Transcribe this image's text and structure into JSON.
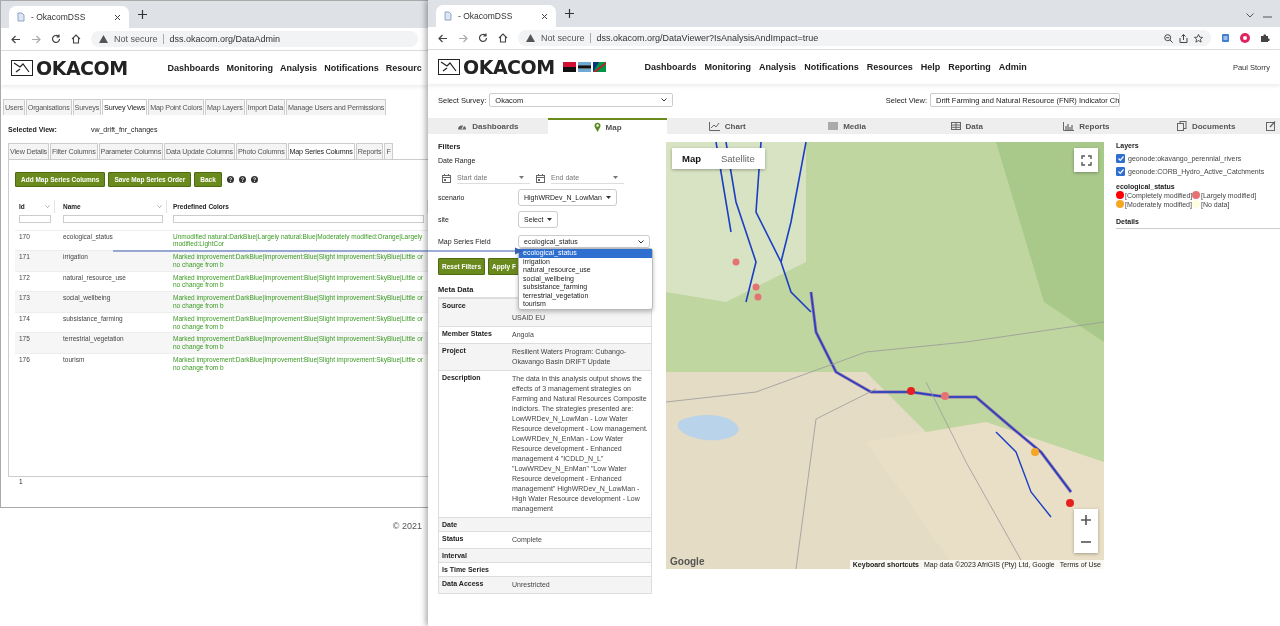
{
  "admin_window": {
    "tab_title": "- OkacomDSS",
    "security": "Not secure",
    "url": "dss.okacom.org/DataAdmin",
    "logo": "OKACOM",
    "nav": [
      "Dashboards",
      "Monitoring",
      "Analysis",
      "Notifications",
      "Resourc"
    ],
    "admin_tabs": [
      {
        "label": "Users",
        "selected": false
      },
      {
        "label": "Organisations",
        "selected": false
      },
      {
        "label": "Surveys",
        "selected": false
      },
      {
        "label": "Survey Views",
        "selected": true
      },
      {
        "label": "Map Point Colors",
        "selected": false
      },
      {
        "label": "Map Layers",
        "selected": false
      },
      {
        "label": "Import Data",
        "selected": false
      },
      {
        "label": "Manage Users and Permissions",
        "selected": false
      }
    ],
    "selected_view": {
      "label": "Selected View:",
      "value": "vw_drift_fnr_changes"
    },
    "view_tabs": [
      {
        "label": "View Details",
        "selected": false
      },
      {
        "label": "Filter Columns",
        "selected": false
      },
      {
        "label": "Parameter Columns",
        "selected": false
      },
      {
        "label": "Data Update Columns",
        "selected": false
      },
      {
        "label": "Photo Columns",
        "selected": false
      },
      {
        "label": "Map Series Columns",
        "selected": true
      },
      {
        "label": "Reports",
        "selected": false
      },
      {
        "label": "F",
        "selected": false
      }
    ],
    "buttons": [
      "Add Map Series Columns",
      "Save Map Series Order",
      "Back"
    ],
    "table": {
      "columns": [
        "Id",
        "Name",
        "Predefined Colors"
      ],
      "rows": [
        {
          "id": "170",
          "name": "ecological_status",
          "colors": "Unmodified natural:DarkBlue|Largely natural:Blue|Moderately modified:Orange|Largely modified:LightCor"
        },
        {
          "id": "171",
          "name": "irrigation",
          "colors": "Marked improvement:DarkBlue|Improvement:Blue|Slight improvement:SkyBlue|Little or no change from b"
        },
        {
          "id": "172",
          "name": "natural_resource_use",
          "colors": "Marked improvement:DarkBlue|Improvement:Blue|Slight improvement:SkyBlue|Little or no change from b"
        },
        {
          "id": "173",
          "name": "social_wellbeing",
          "colors": "Marked improvement:DarkBlue|Improvement:Blue|Slight improvement:SkyBlue|Little or no change from b"
        },
        {
          "id": "174",
          "name": "subsistance_farming",
          "colors": "Marked improvement:DarkBlue|Improvement:Blue|Slight improvement:SkyBlue|Little or no change from b"
        },
        {
          "id": "175",
          "name": "terrestrial_vegetation",
          "colors": "Marked improvement:DarkBlue|Improvement:Blue|Slight improvement:SkyBlue|Little or no change from b"
        },
        {
          "id": "176",
          "name": "tourism",
          "colors": "Marked improvement:DarkBlue|Improvement:Blue|Slight improvement:SkyBlue|Little or no change from b"
        }
      ]
    },
    "pager": "1"
  },
  "footer": "© 2021",
  "viewer_window": {
    "tab_title": "- OkacomDSS",
    "security": "Not secure",
    "url": "dss.okacom.org/DataViewer?IsAnalysisAndImpact=true",
    "logo": "OKACOM",
    "nav": [
      "Dashboards",
      "Monitoring",
      "Analysis",
      "Notifications",
      "Resources",
      "Help",
      "Reporting",
      "Admin"
    ],
    "user": "Paul Storry",
    "survey": {
      "label": "Select Survey:",
      "value": "Okacom"
    },
    "view": {
      "label": "Select View:",
      "value": "Drift Farming and Natural Resource (FNR) Indicator Ch"
    },
    "tabs": [
      {
        "label": "Dashboards",
        "selected": false
      },
      {
        "label": "Map",
        "selected": true
      },
      {
        "label": "Chart",
        "selected": false
      },
      {
        "label": "Media",
        "selected": false
      },
      {
        "label": "Data",
        "selected": false
      },
      {
        "label": "Reports",
        "selected": false
      },
      {
        "label": "Documents",
        "selected": false
      }
    ],
    "filters": {
      "title": "Filters",
      "date_range": "Date Range",
      "start_placeholder": "Start date",
      "end_placeholder": "End date",
      "scenario": {
        "label": "scenario",
        "value": "HighWRDev_N_LowMan"
      },
      "site": {
        "label": "site",
        "value": "Select"
      },
      "series_field": {
        "label": "Map Series Field",
        "value": "ecological_status",
        "options": [
          {
            "label": "ecological_status",
            "selected": true
          },
          {
            "label": "irrigation",
            "selected": false
          },
          {
            "label": "natural_resource_use",
            "selected": false
          },
          {
            "label": "social_wellbeing",
            "selected": false
          },
          {
            "label": "subsistance_farming",
            "selected": false
          },
          {
            "label": "terrestrial_vegetation",
            "selected": false
          },
          {
            "label": "tourism",
            "selected": false
          }
        ]
      },
      "buttons": [
        "Reset Filters",
        "Apply F"
      ]
    },
    "meta": {
      "title": "Meta Data",
      "rows": [
        {
          "label": "Source",
          "value": "USAID EU"
        },
        {
          "label": "Member States",
          "value": "Angola"
        },
        {
          "label": "Project",
          "value": "Resilient Waters Program: Cubango-Okavango Basin DRIFT Update"
        },
        {
          "label": "Description",
          "value": "The data in this analysis output shows the effects of 3 management strategies on Farming and Natural Resources Composite indictors. The strategies presented are: LowWRDev_N_LowMan - Low Water Resource development - Low management. LowWRDev_N_EnMan - Low Water Resource development - Enhanced management 4 \"ICDLD_N_L\" \"LowWRDev_N_EnMan\" \"Low Water Resource development - Enhanced management\" HighWRDev_N_LowMan - High Water Resource development - Low management"
        },
        {
          "label": "Date",
          "value": ""
        },
        {
          "label": "Status",
          "value": "Complete"
        },
        {
          "label": "Interval",
          "value": ""
        },
        {
          "label": "Is Time Series",
          "value": ""
        },
        {
          "label": "Data Access",
          "value": "Unrestricted"
        }
      ]
    },
    "map": {
      "types": [
        {
          "label": "Map",
          "selected": true
        },
        {
          "label": "Satellite",
          "selected": false
        }
      ],
      "brand": "Google",
      "attribution": [
        "Keyboard shortcuts",
        "Map data ©2023 AfriGIS (Pty) Ltd, Google",
        "Terms of Use"
      ]
    },
    "layers": {
      "title": "Layers",
      "items": [
        {
          "label": "geonode:okavango_perennial_rivers",
          "checked": true
        },
        {
          "label": "geonode:CORB_Hydro_Active_Catchments",
          "checked": true
        }
      ]
    },
    "legend": {
      "title": "ecological_status",
      "items": [
        {
          "label": "[Completely modified]",
          "color": "#ff0000"
        },
        {
          "label": "[Largely modified]",
          "color": "#e57373"
        },
        {
          "label": "[Moderately modified]",
          "color": "#f5a623"
        },
        {
          "label": "[No data]",
          "color": "#fffde0"
        }
      ]
    },
    "details": "Details"
  }
}
